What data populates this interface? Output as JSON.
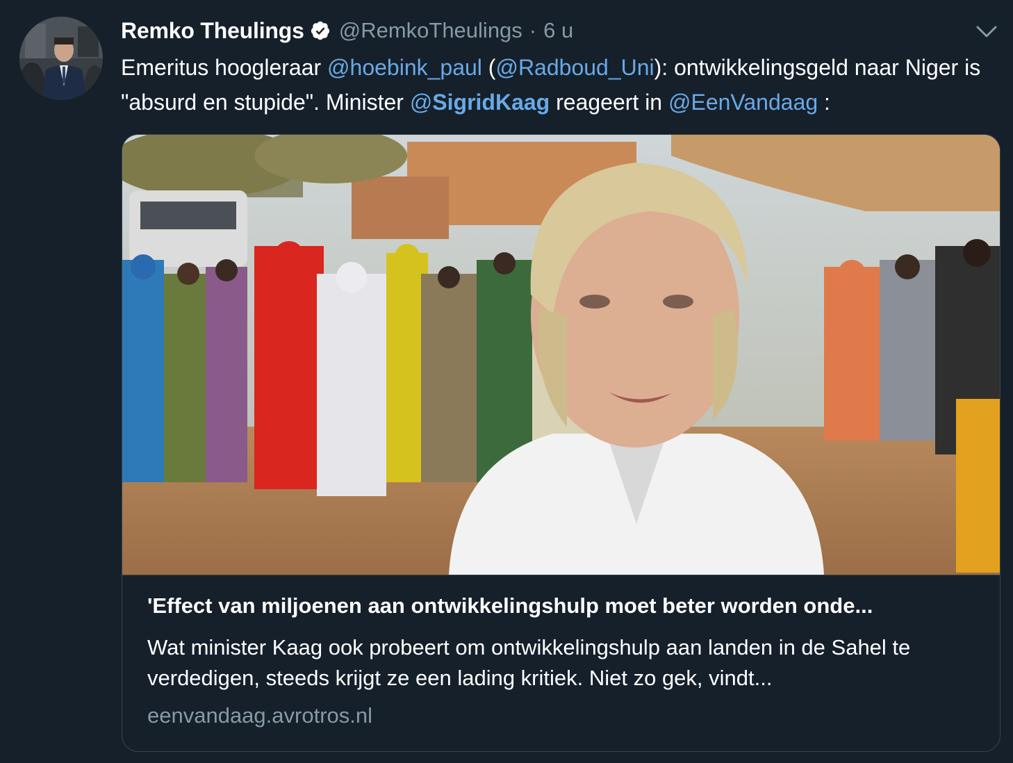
{
  "tweet": {
    "author": {
      "display_name": "Remko Theulings",
      "handle": "@RemkoTheulings",
      "verified": true
    },
    "separator": "·",
    "time": "6 u",
    "text": {
      "part1": "Emeritus hoogleraar ",
      "mention1": "@hoebink_paul",
      "part2": " (",
      "mention2": "@Radboud_Uni",
      "part3": "): ontwikkelingsgeld naar Niger is \"absurd en stupide\". Minister ",
      "mention3_prefix": "@",
      "mention3_name": "SigridKaag",
      "part4": " reageert in ",
      "mention4": "@EenVandaag",
      "part5": " :"
    },
    "card": {
      "title": "'Effect van miljoenen aan ontwikkelingshulp moet beter worden onde...",
      "description": "Wat minister Kaag ook probeert om ontwikkelingshulp aan landen in de Sahel te verdedigen, steeds krijgt ze een lading kritiek. Niet zo gek, vindt...",
      "domain": "eenvandaag.avrotros.nl"
    }
  },
  "colors": {
    "background": "#15202b",
    "link": "#6aa9e6",
    "secondary_text": "#8899a6",
    "border": "#38444d"
  },
  "icons": {
    "verified": "verified-badge-icon",
    "menu": "chevron-down-icon"
  }
}
